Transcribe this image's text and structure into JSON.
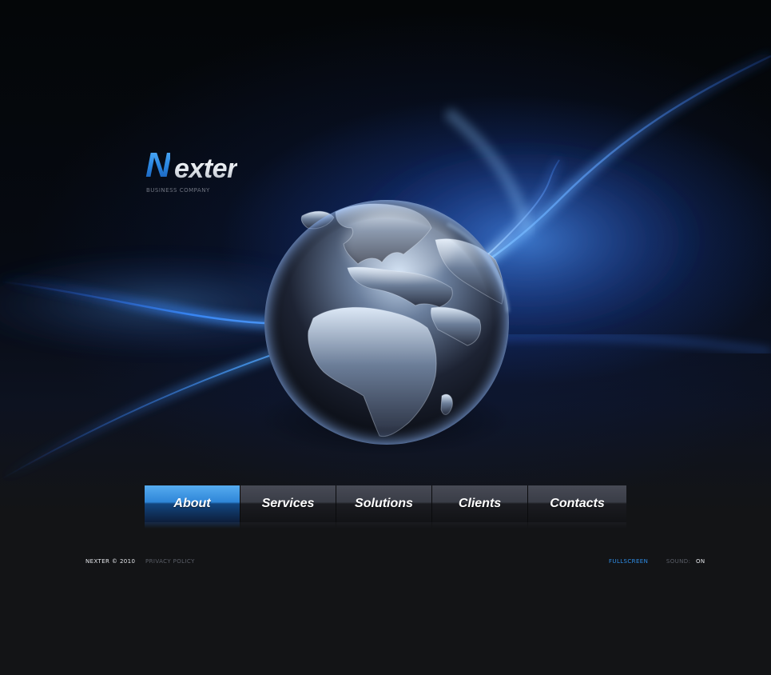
{
  "colors": {
    "background": "#131416",
    "accent_blue": "#2f8ee8",
    "nav_active": "#2f86d8",
    "nav_inactive": "#3a3d47",
    "text_light": "#e6e8ec",
    "text_muted": "#5b5f68"
  },
  "logo": {
    "mark": "N",
    "rest": "exter",
    "tagline": "BUSINESS COMPANY"
  },
  "hero": {
    "icon": "globe-icon"
  },
  "nav": {
    "items": [
      {
        "label": "About",
        "active": true
      },
      {
        "label": "Services",
        "active": false
      },
      {
        "label": "Solutions",
        "active": false
      },
      {
        "label": "Clients",
        "active": false
      },
      {
        "label": "Contacts",
        "active": false
      }
    ]
  },
  "footer": {
    "copyright": "NEXTER © 2010",
    "privacy": "PRIVACY POLICY",
    "fullscreen": "FULLSCREEN",
    "sound_label": "SOUND:",
    "sound_value": "ON"
  }
}
